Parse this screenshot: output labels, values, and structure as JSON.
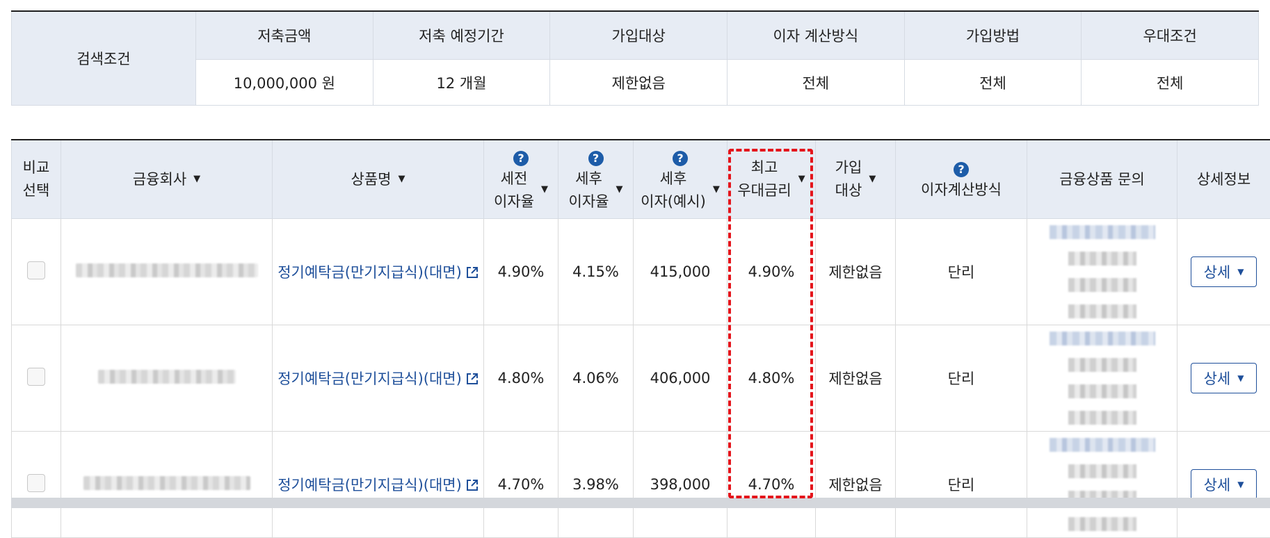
{
  "search": {
    "label": "검색조건",
    "headers": [
      "저축금액",
      "저축 예정기간",
      "가입대상",
      "이자 계산방식",
      "가입방법",
      "우대조건"
    ],
    "values": [
      "10,000,000 원",
      "12 개월",
      "제한없음",
      "전체",
      "전체",
      "전체"
    ]
  },
  "results": {
    "headers": {
      "compare": [
        "비교",
        "선택"
      ],
      "company": "금융회사",
      "product": "상품명",
      "pre_tax_rate": [
        "세전",
        "이자율"
      ],
      "after_tax_rate": [
        "세후",
        "이자율"
      ],
      "after_tax_interest": [
        "세후",
        "이자(예시)"
      ],
      "max_pref_rate": [
        "최고",
        "우대금리"
      ],
      "join_target": [
        "가입",
        "대상"
      ],
      "calc_method": "이자계산방식",
      "inquiry": "금융상품 문의",
      "detail": "상세정보"
    },
    "rows": [
      {
        "product": "정기예탁금(만기지급식)(대면)",
        "pre_tax": "4.90%",
        "after_tax": "4.15%",
        "interest": "415,000",
        "max_rate": "4.90%",
        "target": "제한없음",
        "method": "단리",
        "detail_label": "상세"
      },
      {
        "product": "정기예탁금(만기지급식)(대면)",
        "pre_tax": "4.80%",
        "after_tax": "4.06%",
        "interest": "406,000",
        "max_rate": "4.80%",
        "target": "제한없음",
        "method": "단리",
        "detail_label": "상세"
      },
      {
        "product": "정기예탁금(만기지급식)(대면)",
        "pre_tax": "4.70%",
        "after_tax": "3.98%",
        "interest": "398,000",
        "max_rate": "4.70%",
        "target": "제한없음",
        "method": "단리",
        "detail_label": "상세"
      }
    ]
  },
  "icons": {
    "help": "question-circle-icon",
    "sort": "caret-down-icon",
    "external": "external-link-icon"
  },
  "colors": {
    "header_bg": "#e7ecf4",
    "link": "#1e4f9a",
    "help_icon": "#1d5ca8",
    "highlight": "#e4141b"
  }
}
